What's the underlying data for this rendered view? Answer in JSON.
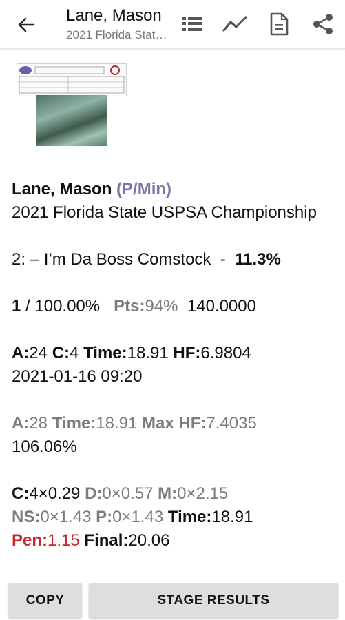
{
  "appbar": {
    "title": "Lane, Mason",
    "subtitle": "2021 Florida State USPSA Championship",
    "icons": [
      "back-arrow-icon",
      "list-icon",
      "chart-line-icon",
      "document-icon",
      "share-icon"
    ]
  },
  "result": {
    "shooter": "Lane, Mason",
    "division": "(P/Min)",
    "match": "2021 Florida State USPSA Championship",
    "stage": "2: – I’m Da Boss Comstock",
    "stage_sep": "-",
    "stage_percent": "11.3%",
    "place": "1",
    "place_percent": "/ 100.00%",
    "pts_label": "Pts:",
    "pts_value": "94%",
    "points": "140.0000",
    "a_label": "A:",
    "a_value": "24",
    "c_label": "C:",
    "c_value": "4",
    "time_label": "Time:",
    "time_value": "18.91",
    "hf_label": "HF:",
    "hf_value": "6.9804",
    "datetime": "2021-01-16 09:20",
    "max_a_label": "A:",
    "max_a_value": "28",
    "max_time_label": "Time:",
    "max_time_value": "18.91",
    "max_hf_label": "Max HF:",
    "max_hf_value": "7.4035",
    "ratio": "106.06%",
    "c_pen_label": "C:",
    "c_pen_value": "4×0.29",
    "d_label": "D:",
    "d_value": "0×0.57",
    "m_label": "M:",
    "m_value": "0×2.15",
    "ns_label": "NS:",
    "ns_value": "0×1.43",
    "p_label": "P:",
    "p_value": "0×1.43",
    "time2_label": "Time:",
    "time2_value": "18.91",
    "pen_label": "Pen:",
    "pen_value": "1.15",
    "final_label": "Final:",
    "final_value": "20.06"
  },
  "buttons": {
    "copy": "COPY",
    "stage_results": "STAGE RESULTS"
  },
  "colors": {
    "accent": "#7d74a8",
    "penalty": "#c62828",
    "muted": "#7c7c7c",
    "button_bg": "#dedede"
  }
}
